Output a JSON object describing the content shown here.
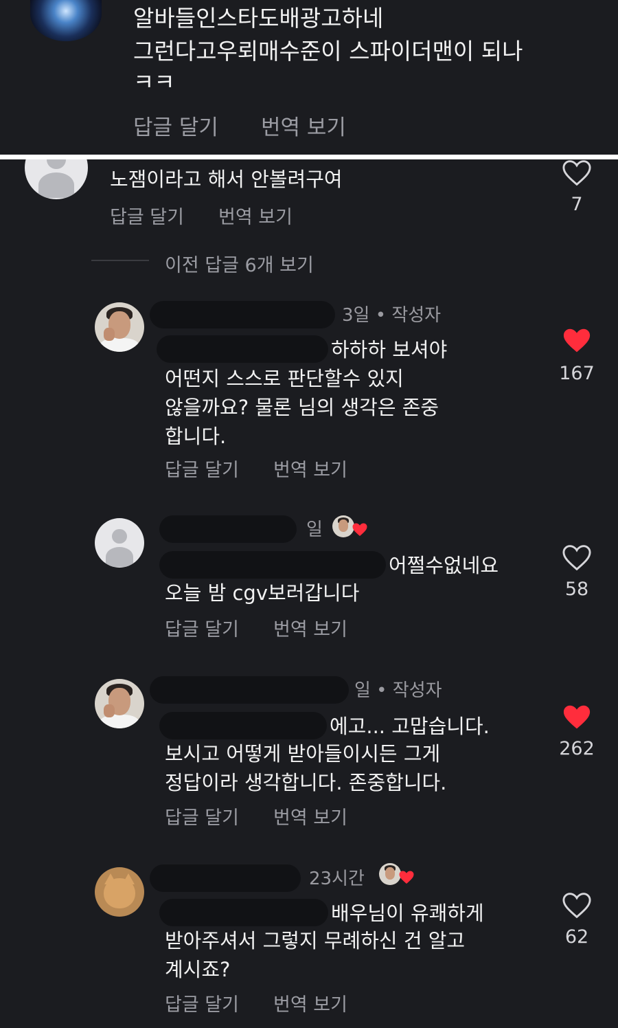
{
  "colors": {
    "background": "#1b1c20",
    "text": "#f2f2f2",
    "muted": "#9b9ca3",
    "heart_red": "#ff2d3c",
    "divider": "#ffffff"
  },
  "top_comment": {
    "lines": [
      "알바들인스타도배광고하네",
      "그런다고우뢰매수준이 스파이더맨이 되나",
      "ㅋㅋ"
    ],
    "reply_label": "답글 달기",
    "translate_label": "번역 보기"
  },
  "parent_comment": {
    "text": "노잼이라고 해서 안볼려구여",
    "reply_label": "답글 달기",
    "translate_label": "번역 보기",
    "likes": "7",
    "liked": false
  },
  "view_previous": "이전 답글 6개 보기",
  "replies": [
    {
      "meta": "3일 • 작성자",
      "lines": [
        "하하하 보셔야",
        "어떤지 스스로 판단할수 있지",
        "않을까요? 물론 님의 생각은 존중",
        "합니다."
      ],
      "reply_label": "답글 달기",
      "translate_label": "번역 보기",
      "likes": "167",
      "liked": true,
      "avatar": "author-photo"
    },
    {
      "meta": "일",
      "lines": [
        "어쩔수없네요",
        "오늘 밤 cgv보러갑니다"
      ],
      "reply_label": "답글 달기",
      "translate_label": "번역 보기",
      "likes": "58",
      "liked": false,
      "avatar": "default-user",
      "author_liked_badge": true
    },
    {
      "meta": "일 • 작성자",
      "lines": [
        "에고... 고맙습니다.",
        "보시고 어떻게 받아들이시든 그게",
        "정답이라 생각합니다. 존중합니다."
      ],
      "reply_label": "답글 달기",
      "translate_label": "번역 보기",
      "likes": "262",
      "liked": true,
      "avatar": "author-photo"
    },
    {
      "meta": "23시간",
      "lines": [
        "배우님이 유쾌하게",
        "받아주셔서 그렇지 무례하신 건 알고",
        "계시죠?"
      ],
      "reply_label": "답글 달기",
      "translate_label": "번역 보기",
      "likes": "62",
      "liked": false,
      "avatar": "cat-photo",
      "author_liked_badge": true
    }
  ]
}
